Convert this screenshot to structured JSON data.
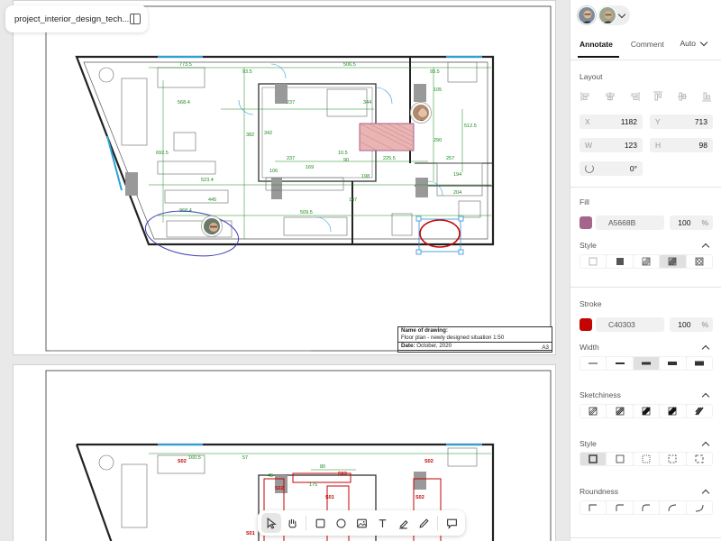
{
  "file_tab": {
    "name": "project_interior_design_tech..."
  },
  "title_block": {
    "name_label": "Name of drawing:",
    "name_value": "Floor plan - newly designed situation 1:50",
    "date_label": "Date:",
    "date_value": "October, 2020",
    "size": "A3"
  },
  "dimensions": [
    "773.5",
    "93.5",
    "506.5",
    "93.5",
    "568.4",
    "237",
    "344",
    "692.5",
    "382",
    "342",
    "105",
    "290",
    "512.5",
    "237",
    "10.5",
    "225.5",
    "257",
    "106",
    "169",
    "90",
    "523.4",
    "198",
    "194",
    "147",
    "204",
    "445",
    "509.5",
    "968.4",
    "80",
    "45",
    "175",
    "160.5",
    "57"
  ],
  "sheet2_labels": [
    "S02",
    "S03",
    "S02",
    "S02",
    "S01",
    "S02",
    "S01"
  ],
  "panel": {
    "tabs": [
      "Annotate",
      "Comment"
    ],
    "auto_label": "Auto",
    "layout": {
      "title": "Layout",
      "x_label": "X",
      "x_value": "1182",
      "y_label": "Y",
      "y_value": "713",
      "w_label": "W",
      "w_value": "123",
      "h_label": "H",
      "h_value": "98",
      "rotation": "0°"
    },
    "fill": {
      "title": "Fill",
      "color": "#A5668B",
      "hex": "A5668B",
      "opacity": "100",
      "unit": "%"
    },
    "fill_style": {
      "title": "Style"
    },
    "stroke": {
      "title": "Stroke",
      "color": "#C40303",
      "hex": "C40303",
      "opacity": "100",
      "unit": "%"
    },
    "width": {
      "title": "Width"
    },
    "sketchiness": {
      "title": "Sketchiness"
    },
    "stroke_style": {
      "title": "Style"
    },
    "roundness": {
      "title": "Roundness"
    }
  },
  "colors": {
    "accent_red": "#C40303",
    "fill_purple": "#A5668B",
    "dim_green": "#1a8a1a",
    "selection_blue": "#2b8fd6"
  }
}
